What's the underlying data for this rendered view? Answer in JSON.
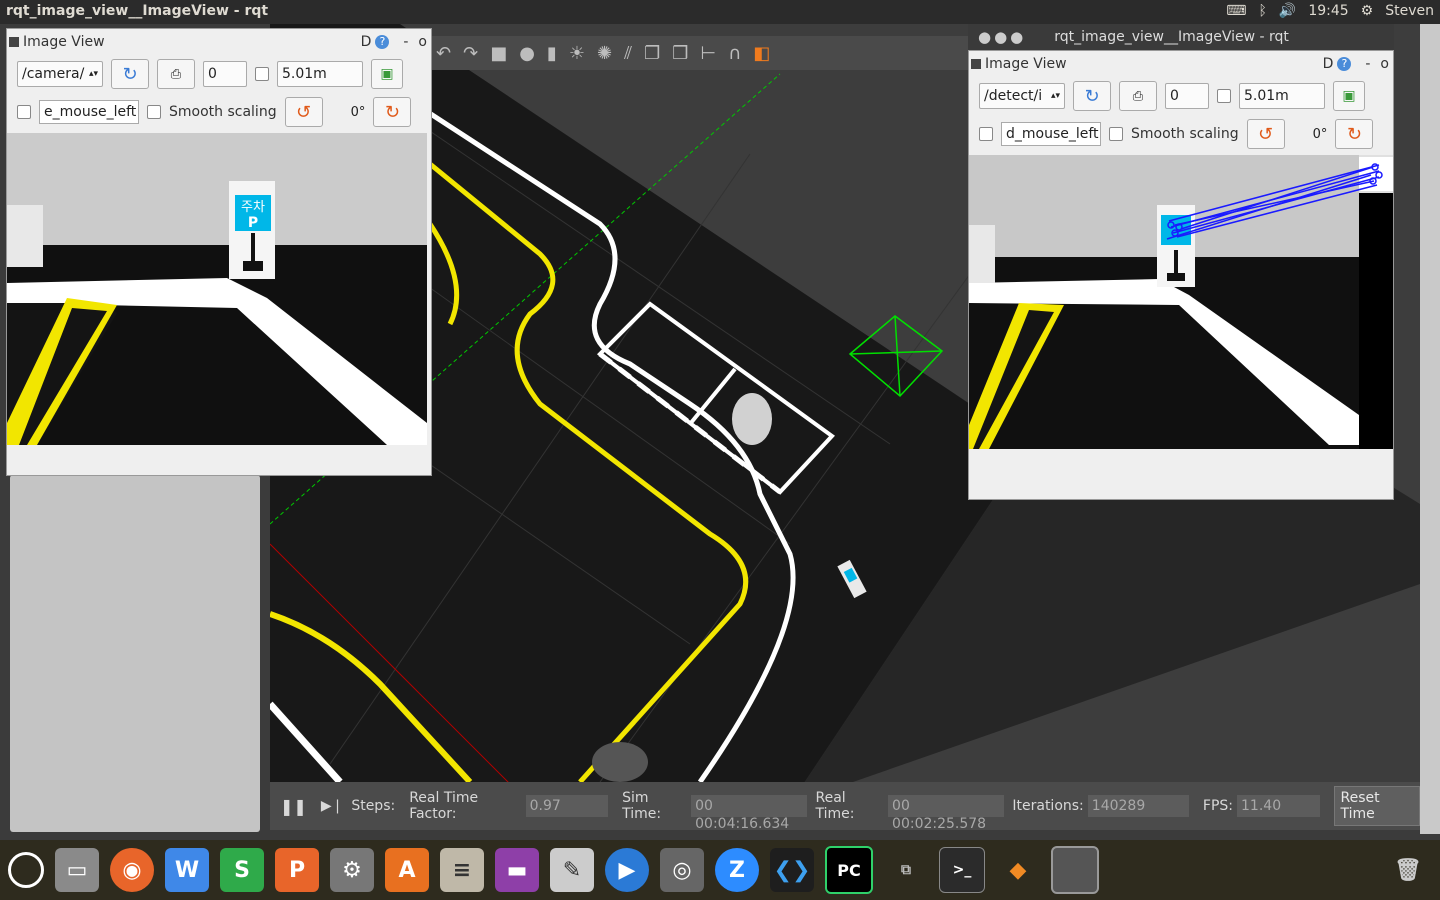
{
  "topbar": {
    "window_title": "rqt_image_view__ImageView - rqt",
    "clock": "19:45",
    "user": "Steven"
  },
  "left_image_view": {
    "title": "Image View",
    "title_buttons": "D",
    "topic": "/camera/",
    "number_value": "0",
    "distance_value": "5.01m",
    "mouse_topic": "e_mouse_left",
    "smooth_label": "Smooth scaling",
    "rotation": "0°",
    "sign_text": "주차",
    "sign_letter": "P"
  },
  "right_window": {
    "title": "rqt_image_view__ImageView - rqt"
  },
  "right_image_view": {
    "title": "Image View",
    "title_buttons": "D",
    "topic": "/detect/i",
    "number_value": "0",
    "distance_value": "5.01m",
    "mouse_topic": "d_mouse_left",
    "smooth_label": "Smooth scaling",
    "rotation": "0°"
  },
  "statusbar": {
    "steps_label": "Steps:",
    "rtf_label": "Real Time Factor:",
    "rtf_value": "0.97",
    "sim_label": "Sim Time:",
    "sim_value": "00 00:04:16.634",
    "real_label": "Real Time:",
    "real_value": "00 00:02:25.578",
    "iter_label": "Iterations:",
    "iter_value": "140289",
    "fps_label": "FPS:",
    "fps_value": "11.40",
    "reset_label": "Reset Time"
  },
  "colors": {
    "road_yellow": "#f2e600",
    "sign_blue": "#00b7e8",
    "frustum_green": "#00c800",
    "match_lines_blue": "#1a1aff"
  },
  "dock_icons": [
    "ubuntu-icon",
    "files-icon",
    "firefox-icon",
    "writer-icon",
    "calc-icon",
    "impress-icon",
    "settings-icon",
    "software-center-icon",
    "mixer-icon",
    "video-icon",
    "paint-icon",
    "media-player-icon",
    "film-icon",
    "zoom-icon",
    "vscode-icon",
    "pycharm-icon",
    "windows-icon",
    "terminal-icon",
    "sublime-icon",
    "gazebo-icon",
    "trash-icon"
  ],
  "dock_labels": {
    "writer": "W",
    "calc": "S",
    "impress": "P",
    "pycharm": "PC",
    "zoom": "Z"
  }
}
